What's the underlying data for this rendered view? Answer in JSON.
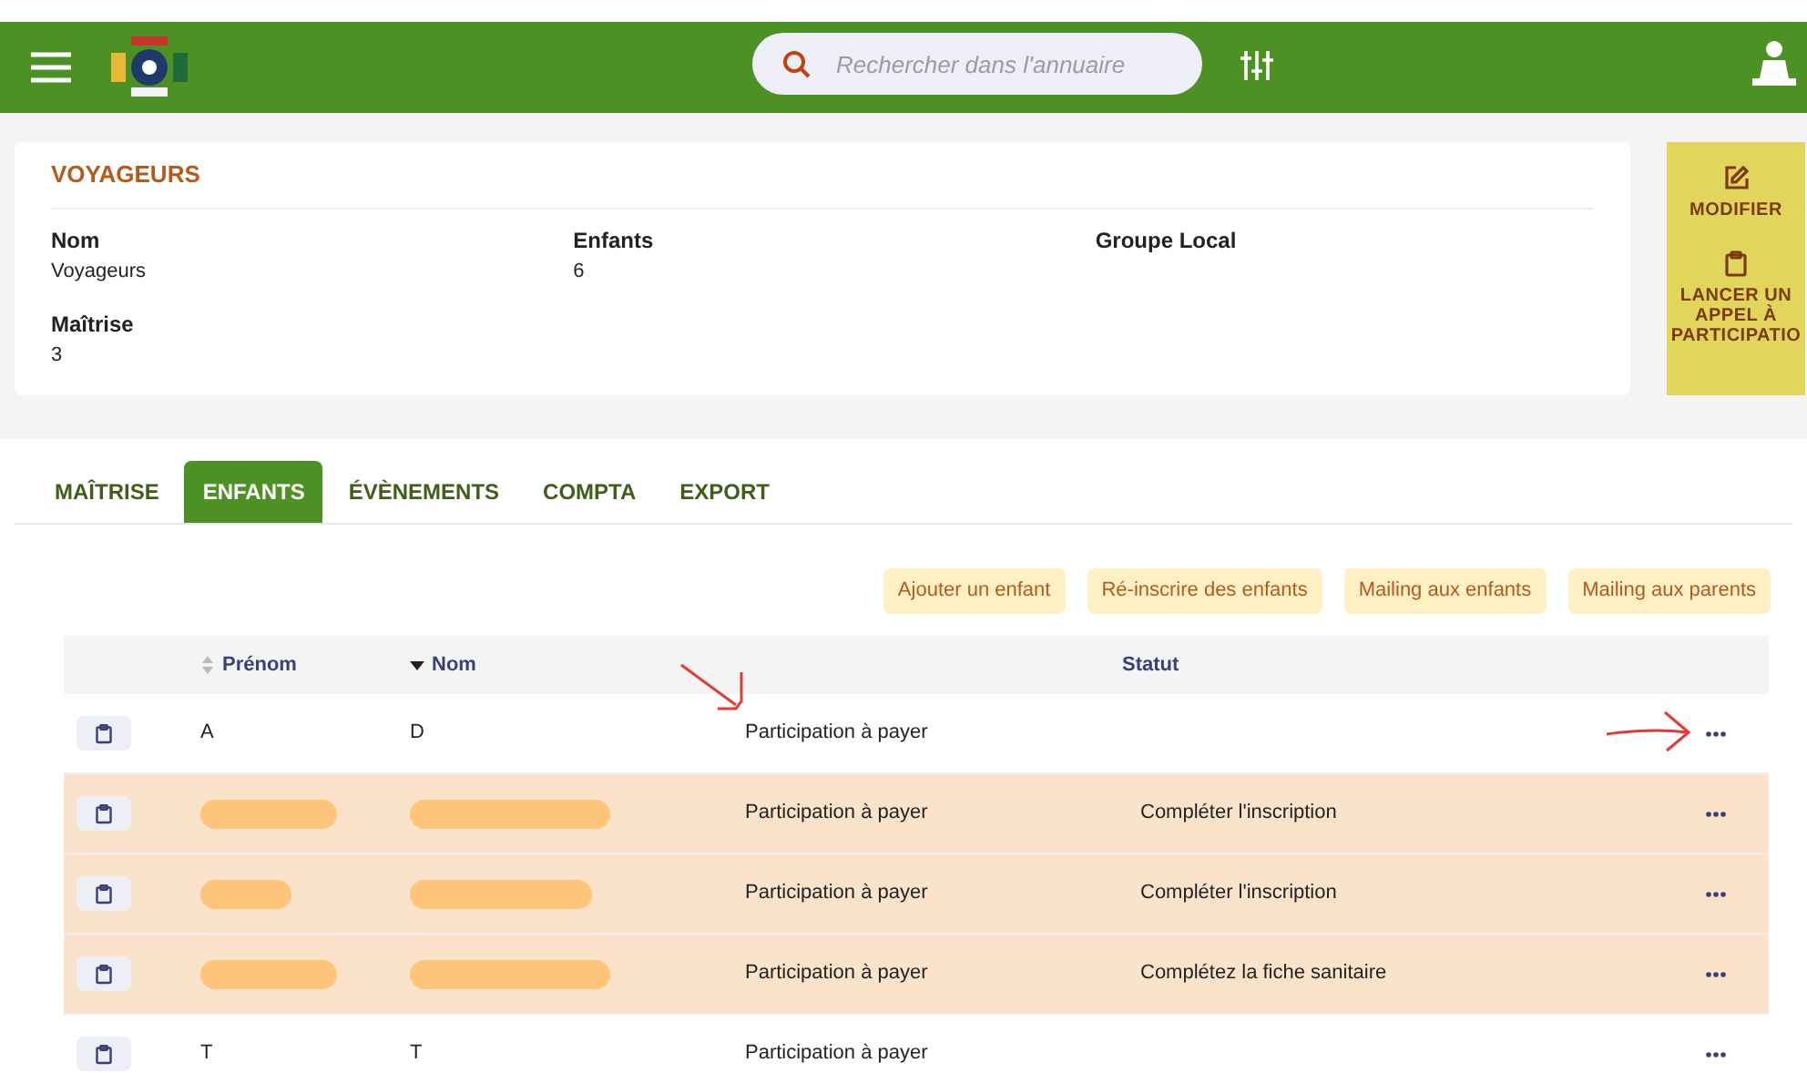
{
  "header": {
    "search": {
      "placeholder": "Rechercher dans l'annuaire"
    }
  },
  "unit": {
    "title": "VOYAGEURS",
    "fields": [
      {
        "label": "Nom",
        "value": "Voyageurs"
      },
      {
        "label": "Enfants",
        "value": "6"
      },
      {
        "label": "Groupe Local"
      },
      {
        "label": "Maîtrise",
        "value": "3"
      }
    ]
  },
  "actions": [
    {
      "kind": "edit",
      "label": "MODIFIER"
    },
    {
      "kind": "clipboard",
      "label": "LANCER UN APPEL À PARTICIPATIO"
    }
  ],
  "tabs": [
    {
      "label": "MAÎTRISE",
      "selected": false
    },
    {
      "label": "ENFANTS",
      "selected": true
    },
    {
      "label": "ÉVÈNEMENTS",
      "selected": false
    },
    {
      "label": "COMPTA",
      "selected": false
    },
    {
      "label": "EXPORT",
      "selected": false
    }
  ],
  "toolbar": [
    "Ajouter un enfant",
    "Ré-inscrire des enfants",
    "Mailing aux enfants",
    "Mailing aux parents"
  ],
  "table": {
    "columns": [
      {
        "label": "Prénom",
        "sortable": true,
        "sorted": false
      },
      {
        "label": "Nom",
        "sortable": true,
        "sorted": true
      },
      {
        "label": "Statut",
        "sortable": false
      }
    ],
    "rows": [
      {
        "first_name": "A",
        "last_name": "D",
        "payment": "Participation à payer",
        "highlighted": false,
        "redacted": false
      },
      {
        "payment": "Participation à payer",
        "status": "Compléter l'inscription",
        "highlighted": true,
        "redacted": true
      },
      {
        "payment": "Participation à payer",
        "status": "Compléter l'inscription",
        "highlighted": true,
        "redacted": true
      },
      {
        "payment": "Participation à payer",
        "status": "Complétez la fiche sanitaire",
        "highlighted": true,
        "redacted": true
      },
      {
        "first_name": "T",
        "last_name": "T",
        "payment": "Participation à payer",
        "highlighted": false,
        "redacted": false
      }
    ]
  }
}
